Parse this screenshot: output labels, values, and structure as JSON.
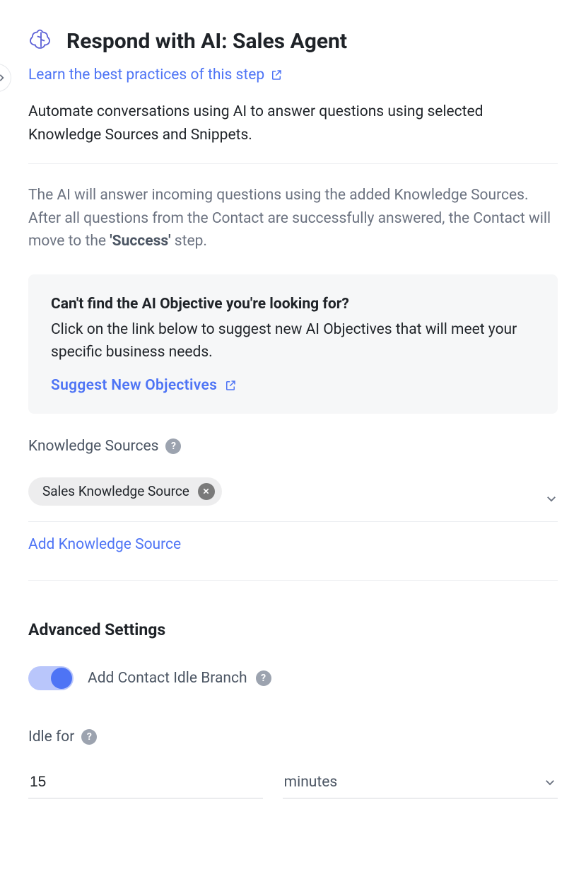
{
  "header": {
    "title": "Respond with AI: Sales Agent",
    "learn_link": "Learn the best practices of this step"
  },
  "description": "Automate conversations using AI to answer questions using selected Knowledge Sources and Snippets.",
  "subdescription_pre": "The AI will answer incoming questions using the added Knowledge Sources. After all questions from the Contact are successfully answered, the Contact will move to the ",
  "subdescription_bold": "'Success'",
  "subdescription_post": " step.",
  "info_card": {
    "title": "Can't find the AI Objective you're looking for?",
    "body": "Click on the link below to suggest new AI Objectives that will meet your specific business needs.",
    "cta": "Suggest New Objectives"
  },
  "knowledge": {
    "label": "Knowledge Sources",
    "chips": [
      "Sales Knowledge Source"
    ],
    "add_link": "Add Knowledge Source"
  },
  "advanced": {
    "title": "Advanced Settings",
    "toggle_label": "Add Contact Idle Branch",
    "toggle_on": true
  },
  "idle": {
    "label": "Idle for",
    "value": "15",
    "unit": "minutes"
  },
  "icons": {
    "brain": "brain-icon",
    "external": "external-link-icon",
    "help": "help-icon",
    "close": "close-icon",
    "chevron_down": "chevron-down-icon",
    "chevron_right": "chevron-right-icon"
  }
}
